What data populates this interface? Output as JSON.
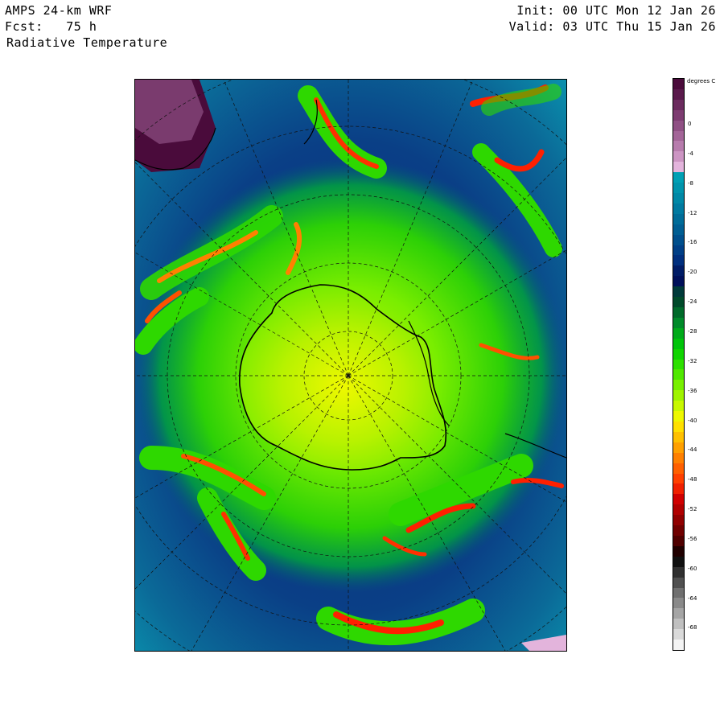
{
  "header": {
    "model": "AMPS 24-km WRF",
    "forecast": "Fcst:   75 h",
    "field": "Radiative Temperature",
    "init": "Init: 00 UTC Mon 12 Jan 26",
    "valid": "Valid: 03 UTC Thu 15 Jan 26"
  },
  "colorbar": {
    "units": "degrees C",
    "labels": [
      "0",
      "-4",
      "-8",
      "-12",
      "-16",
      "-20",
      "-24",
      "-28",
      "-32",
      "-36",
      "-40",
      "-44",
      "-48",
      "-52",
      "-56",
      "-60",
      "-64",
      "-68"
    ],
    "colors": [
      "#4a0b3b",
      "#5a1a4c",
      "#6b2b5e",
      "#7d3c71",
      "#8f5084",
      "#a36598",
      "#b77cad",
      "#cc95c3",
      "#e3b4dc",
      "#00a0b4",
      "#0094ac",
      "#0088a6",
      "#007aa0",
      "#006c98",
      "#005e92",
      "#004f8c",
      "#003f86",
      "#002f7e",
      "#001c66",
      "#00105a",
      "#003a3a",
      "#004a2a",
      "#006a2a",
      "#008a2a",
      "#00aa1a",
      "#00c40a",
      "#10d400",
      "#2ee000",
      "#50e800",
      "#78f000",
      "#a0f400",
      "#c8f800",
      "#eef800",
      "#ffe000",
      "#ffc000",
      "#ffa000",
      "#ff8000",
      "#ff6000",
      "#ff4000",
      "#f02000",
      "#d00000",
      "#b00000",
      "#900000",
      "#700000",
      "#500000",
      "#200000",
      "#101010",
      "#303030",
      "#505050",
      "#707070",
      "#8a8a8a",
      "#a5a5a5",
      "#c0c0c0",
      "#dadada",
      "#f4f4f4"
    ]
  }
}
